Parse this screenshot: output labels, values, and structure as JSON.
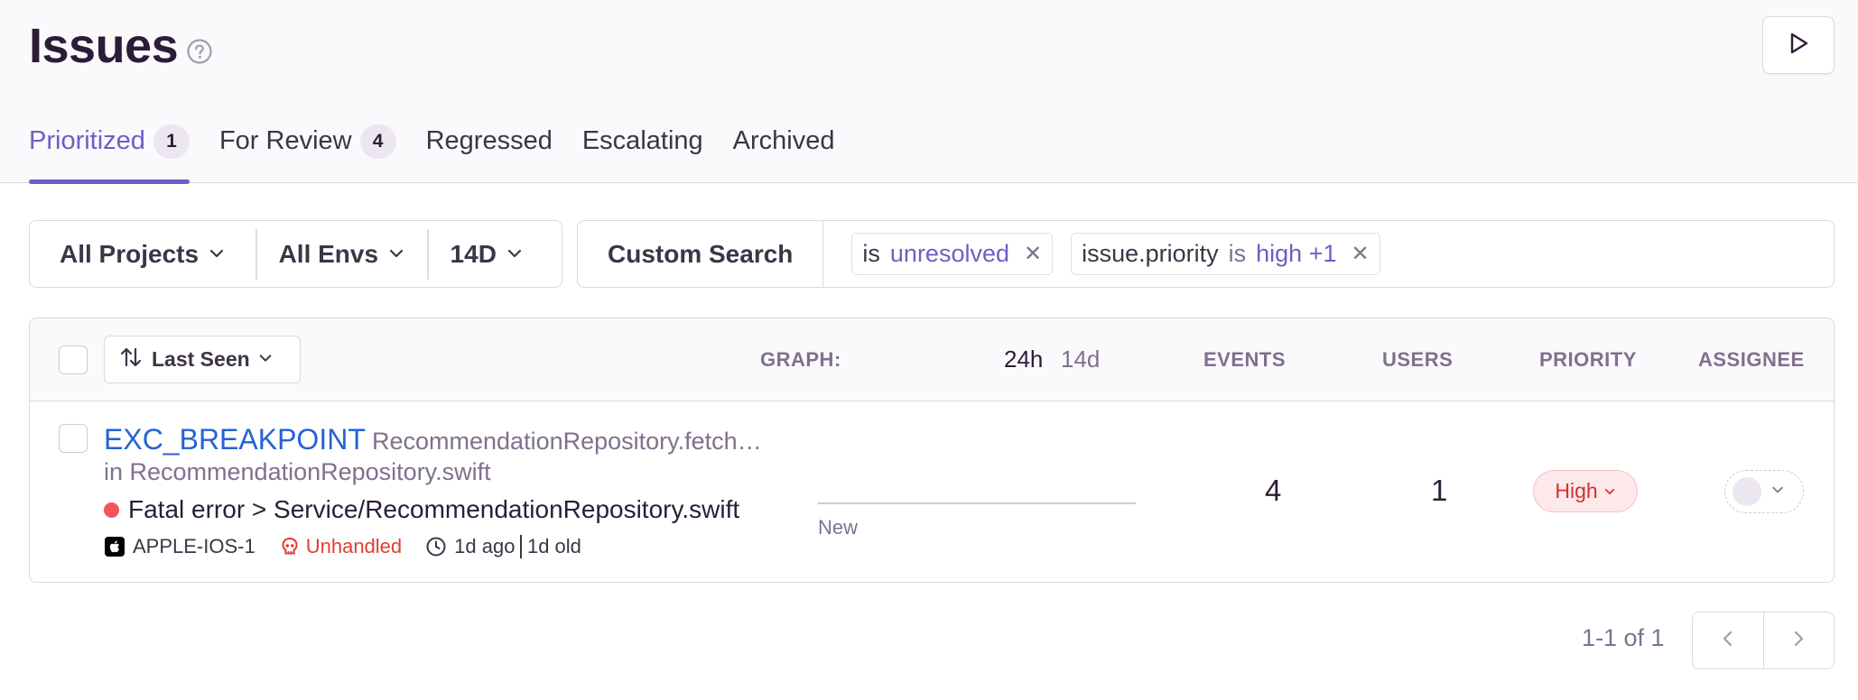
{
  "header": {
    "title": "Issues",
    "help_icon": "question-circle-icon",
    "play_icon": "play-icon"
  },
  "tabs": [
    {
      "label": "Prioritized",
      "count": "1",
      "active": true
    },
    {
      "label": "For Review",
      "count": "4",
      "active": false
    },
    {
      "label": "Regressed",
      "active": false
    },
    {
      "label": "Escalating",
      "active": false
    },
    {
      "label": "Archived",
      "active": false
    }
  ],
  "filters": {
    "projects": "All Projects",
    "envs": "All Envs",
    "period": "14D"
  },
  "search": {
    "label": "Custom Search",
    "tokens": [
      {
        "key": "",
        "op": "is",
        "value": "unresolved"
      },
      {
        "key": "issue.priority",
        "op": "is",
        "value": "high +1"
      }
    ]
  },
  "table": {
    "sort_label": "Last Seen",
    "graph_label": "GRAPH:",
    "graph_period_active": "24h",
    "graph_period_other": "14d",
    "columns": {
      "events": "EVENTS",
      "users": "USERS",
      "priority": "PRIORITY",
      "assignee": "ASSIGNEE"
    },
    "rows": [
      {
        "title": "EXC_BREAKPOINT",
        "culprit": "RecommendationRepository.fetch…",
        "location": "in RecommendationRepository.swift",
        "message": "Fatal error > Service/RecommendationRepository.swift",
        "project": "APPLE-IOS-1",
        "handled": "Unhandled",
        "last_seen": "1d ago",
        "age": "1d old",
        "graph_label": "New",
        "events": "4",
        "users": "1",
        "priority": "High"
      }
    ]
  },
  "pagination": {
    "summary": "1-1 of 1"
  },
  "colors": {
    "accent": "#6c5fc7",
    "link": "#2562d4",
    "error": "#f55459",
    "priority_high": "#d2322c"
  }
}
